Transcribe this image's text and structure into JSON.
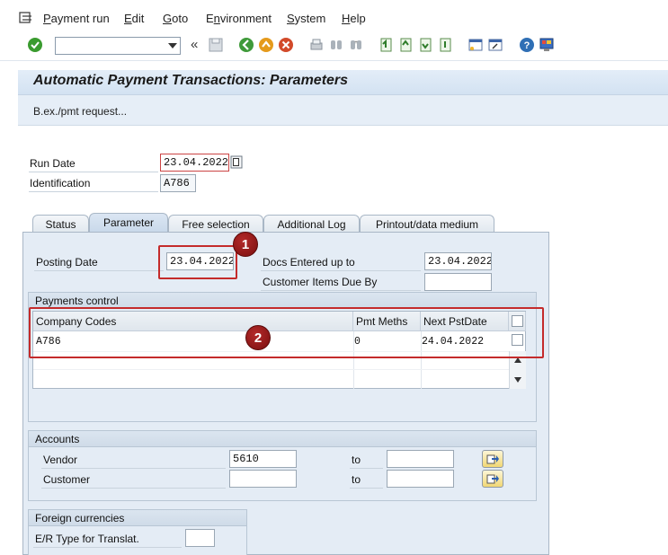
{
  "menu": {
    "items": [
      "Payment run",
      "Edit",
      "Goto",
      "Environment",
      "System",
      "Help"
    ],
    "underline": [
      "P",
      "E",
      "G",
      "n",
      "S",
      "H"
    ]
  },
  "toolbar": {
    "command_value": "",
    "icons": [
      "enter-check-icon",
      "back-icon",
      "exit-icon",
      "cancel-icon",
      "print-icon",
      "find-icon",
      "find-next-icon",
      "first-page-icon",
      "previous-page-icon",
      "next-page-icon",
      "last-page-icon",
      "create-session-icon",
      "shortcut-icon",
      "help-icon",
      "layout-menu-icon"
    ],
    "collapse_symbol": "«"
  },
  "header": {
    "title": "Automatic Payment Transactions: Parameters",
    "app_button": "B.ex./pmt request..."
  },
  "run": {
    "run_date_label": "Run Date",
    "run_date_value": "23.04.2022",
    "identification_label": "Identification",
    "identification_value": "A786"
  },
  "tabs": [
    {
      "label": "Status",
      "active": false
    },
    {
      "label": "Parameter",
      "active": true
    },
    {
      "label": "Free selection",
      "active": false
    },
    {
      "label": "Additional Log",
      "active": false
    },
    {
      "label": "Printout/data medium",
      "active": false
    }
  ],
  "parameter": {
    "posting_date_label": "Posting Date",
    "posting_date_value": "23.04.2022",
    "docs_entered_label": "Docs Entered up to",
    "docs_entered_value": "23.04.2022",
    "customer_items_label": "Customer Items Due By",
    "customer_items_value": ""
  },
  "payments_control": {
    "title": "Payments control",
    "columns": [
      "Company Codes",
      "Pmt Meths",
      "Next PstDate"
    ],
    "rows": [
      {
        "company_code": "A786",
        "pmt_meths": "0",
        "next_pst_date": "24.04.2022"
      }
    ]
  },
  "accounts": {
    "title": "Accounts",
    "vendor_label": "Vendor",
    "vendor_from": "5610",
    "vendor_to": "",
    "customer_label": "Customer",
    "customer_from": "",
    "customer_to": "",
    "to_label": "to"
  },
  "foreign_currencies": {
    "title": "Foreign currencies",
    "er_type_label": "E/R Type for Translat.",
    "er_type_value": ""
  },
  "annotations": {
    "marker_1": "1",
    "marker_2": "2",
    "color": "#c42b2b"
  }
}
